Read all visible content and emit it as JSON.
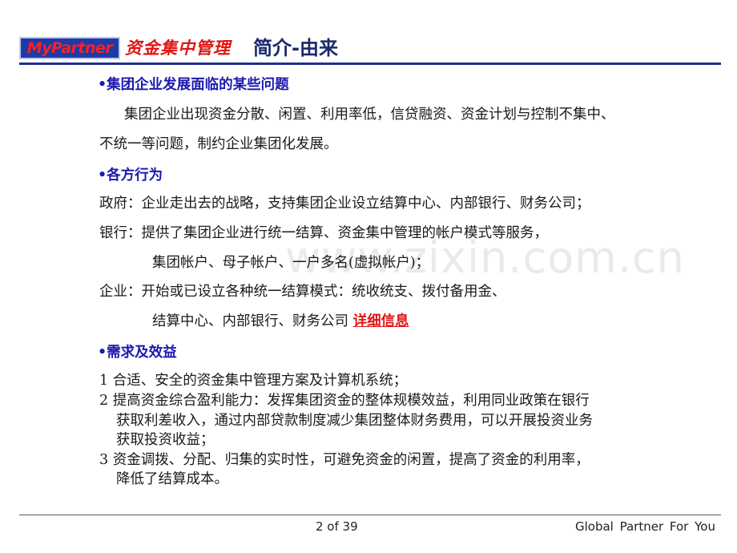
{
  "header": {
    "logo": "MyPartner",
    "brand": "资金集中管理",
    "title": "简介-由来"
  },
  "sections": {
    "s1_heading": "•集团企业发展面临的某些问题",
    "s1_line1": "集团企业出现资金分散、闲置、利用率低，信贷融资、资金计划与控制不集中、",
    "s1_line2": "不统一等问题，制约企业集团化发展。",
    "s2_heading": "•各方行为",
    "s2_gov": "政府：企业走出去的战略，支持集团企业设立结算中心、内部银行、财务公司；",
    "s2_bank1": "银行：提供了集团企业进行统一结算、资金集中管理的帐户模式等服务，",
    "s2_bank2": "集团帐户、母子帐户、一户多名(虚拟帐户)；",
    "s2_ent1": "企业：开始或已设立各种统一结算模式：统收统支、拨付备用金、",
    "s2_ent2": "结算中心、内部银行、财务公司",
    "s2_link": "详细信息",
    "s3_heading": "•需求及效益",
    "s3_l1": "1 合适、安全的资金集中管理方案及计算机系统；",
    "s3_l2a": "2 提高资金综合盈利能力：发挥集团资金的整体规模效益，利用同业政策在银行",
    "s3_l2b": "获取利差收入，通过内部贷款制度减少集团整体财务费用，可以开展投资业务",
    "s3_l2c": "获取投资收益；",
    "s3_l3a": "3 资金调拨、分配、归集的实时性，可避免资金的闲置，提高了资金的利用率，",
    "s3_l3b": "降低了结算成本。"
  },
  "watermark": "www.zixin.com.cn",
  "footer": {
    "page": "2  of 39",
    "tagline": "Global  Partner  For You"
  }
}
